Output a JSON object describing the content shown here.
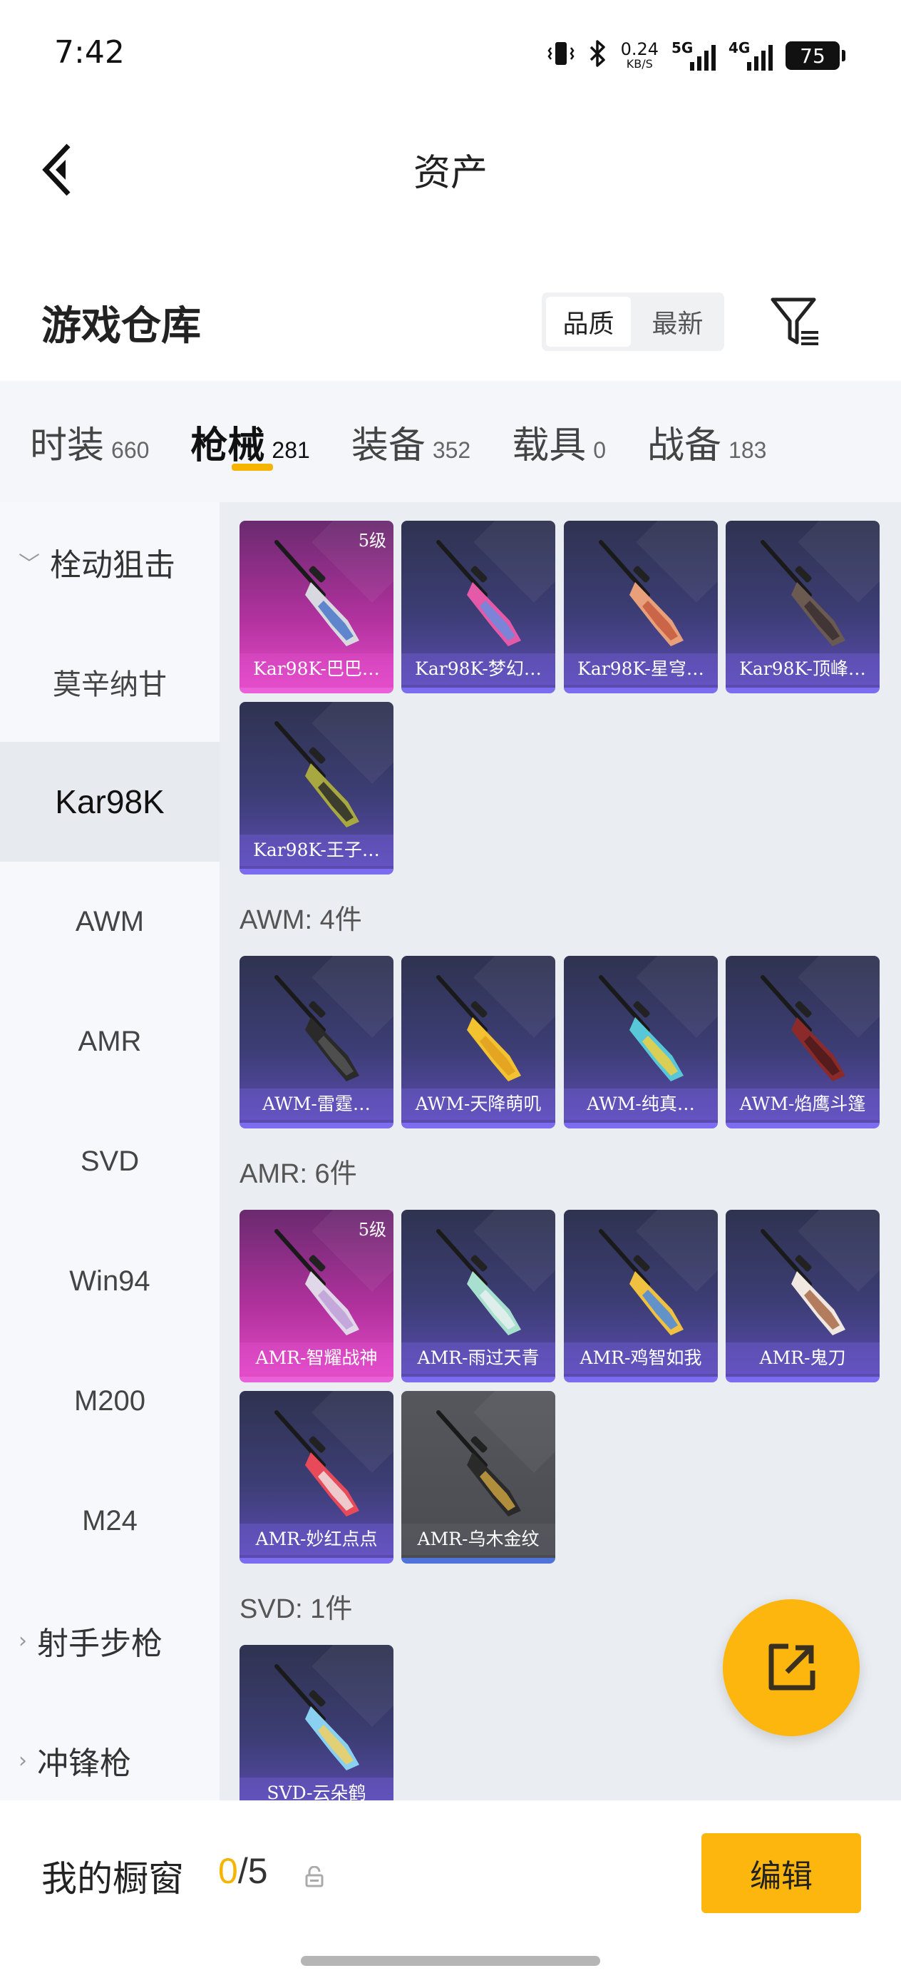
{
  "status_bar": {
    "time": "7:42",
    "net_speed": "0.24",
    "net_unit": "KB/S",
    "sig1_label": "5G",
    "sig2_label": "4G",
    "battery": "75"
  },
  "header": {
    "title": "资产"
  },
  "warehouse": {
    "title": "游戏仓库",
    "sort_options": [
      "品质",
      "最新"
    ],
    "active_sort": "品质"
  },
  "tabs": [
    {
      "label": "时装",
      "count": "660"
    },
    {
      "label": "枪械",
      "count": "281",
      "active": true
    },
    {
      "label": "装备",
      "count": "352"
    },
    {
      "label": "载具",
      "count": "0"
    },
    {
      "label": "战备",
      "count": "183"
    }
  ],
  "sidebar": {
    "items": [
      {
        "label": "栓动狙击",
        "type": "group",
        "arrow": "﹀"
      },
      {
        "label": "莫辛纳甘",
        "type": "item"
      },
      {
        "label": "Kar98K",
        "type": "item",
        "selected": true
      },
      {
        "label": "AWM",
        "type": "item"
      },
      {
        "label": "AMR",
        "type": "item"
      },
      {
        "label": "SVD",
        "type": "item"
      },
      {
        "label": "Win94",
        "type": "item"
      },
      {
        "label": "M200",
        "type": "item"
      },
      {
        "label": "M24",
        "type": "item"
      },
      {
        "label": "射手步枪",
        "type": "group",
        "arrow": "›"
      },
      {
        "label": "冲锋枪",
        "type": "group",
        "arrow": "›"
      }
    ]
  },
  "sections": [
    {
      "label": "",
      "items": [
        {
          "name": "Kar98K-巴巴…",
          "level": "5级",
          "rarity": "pink",
          "colors": [
            "#d8d8e0",
            "#4a78c8"
          ]
        },
        {
          "name": "Kar98K-梦幻…",
          "level": "",
          "rarity": "purple",
          "colors": [
            "#e45aa8",
            "#6a8ce0"
          ]
        },
        {
          "name": "Kar98K-星穹…",
          "level": "",
          "rarity": "purple",
          "colors": [
            "#e8a07a",
            "#c45a40"
          ]
        },
        {
          "name": "Kar98K-顶峰…",
          "level": "",
          "rarity": "purple",
          "colors": [
            "#6a5a52",
            "#3a3030"
          ]
        },
        {
          "name": "Kar98K-王子…",
          "level": "",
          "rarity": "purple",
          "colors": [
            "#a8a840",
            "#2a2a2a"
          ]
        }
      ]
    },
    {
      "label": "AWM: 4件",
      "items": [
        {
          "name": "AWM-雷霆…",
          "level": "",
          "rarity": "purple",
          "colors": [
            "#2a2a2a",
            "#555555"
          ]
        },
        {
          "name": "AWM-天降萌叽",
          "level": "",
          "rarity": "purple",
          "colors": [
            "#f2c230",
            "#e0a020"
          ]
        },
        {
          "name": "AWM-纯真…",
          "level": "",
          "rarity": "purple",
          "colors": [
            "#58c8d8",
            "#f0d040"
          ]
        },
        {
          "name": "AWM-焰鹰斗篷",
          "level": "",
          "rarity": "purple",
          "colors": [
            "#8a2a2a",
            "#4a1a1a"
          ]
        }
      ]
    },
    {
      "label": "AMR: 6件",
      "items": [
        {
          "name": "AMR-智耀战神",
          "level": "5级",
          "rarity": "pink",
          "colors": [
            "#e0d8e8",
            "#c0a0d8"
          ]
        },
        {
          "name": "AMR-雨过天青",
          "level": "",
          "rarity": "purple",
          "colors": [
            "#a8e0d0",
            "#e8f0f0"
          ]
        },
        {
          "name": "AMR-鸡智如我",
          "level": "",
          "rarity": "purple",
          "colors": [
            "#f0c040",
            "#4a8ae0"
          ]
        },
        {
          "name": "AMR-鬼刀",
          "level": "",
          "rarity": "purple",
          "colors": [
            "#f0e8e0",
            "#a86848"
          ]
        },
        {
          "name": "AMR-妙红点点",
          "level": "",
          "rarity": "purple",
          "colors": [
            "#e84a5a",
            "#f0e0e0"
          ]
        },
        {
          "name": "AMR-乌木金纹",
          "level": "",
          "rarity": "grey",
          "colors": [
            "#2a2a2a",
            "#c8a040"
          ]
        }
      ]
    },
    {
      "label": "SVD: 1件",
      "items": [
        {
          "name": "SVD-云朵鹤",
          "level": "",
          "rarity": "purple",
          "colors": [
            "#8ad0f0",
            "#f0d060"
          ]
        }
      ]
    }
  ],
  "bottom_bar": {
    "label": "我的橱窗",
    "current": "0",
    "total": "/5",
    "edit_label": "编辑"
  }
}
